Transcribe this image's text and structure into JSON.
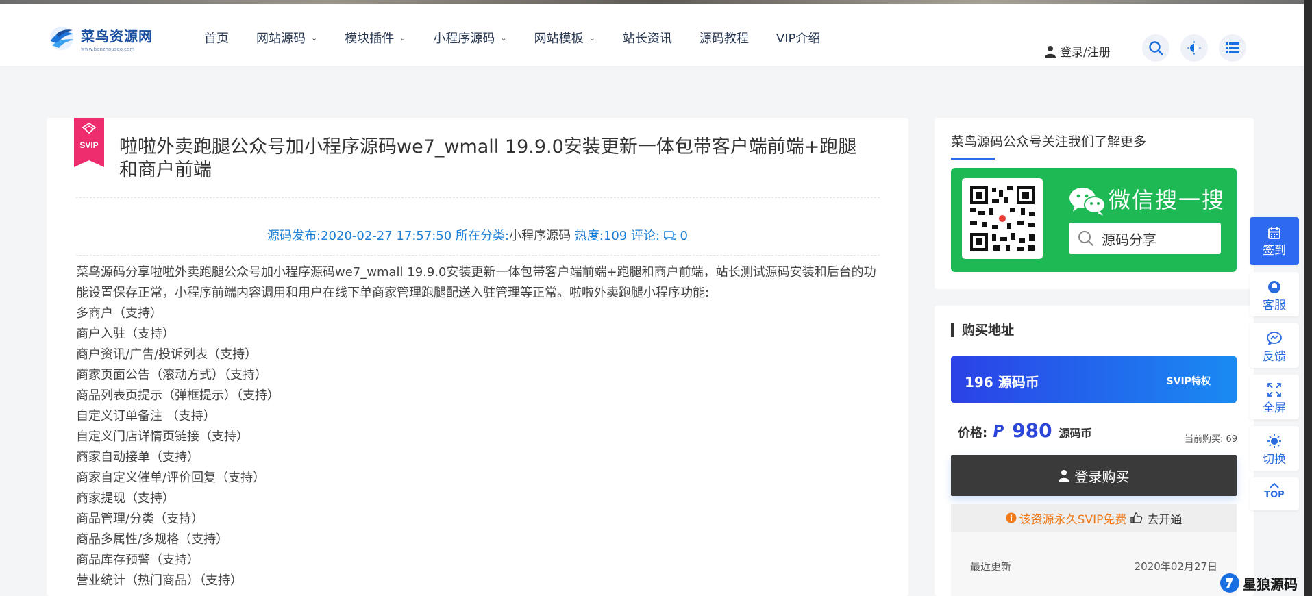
{
  "header": {
    "logo_title": "菜鸟资源网",
    "logo_sub": "www.banzhouseo.com",
    "nav": [
      {
        "label": "首页",
        "has_dropdown": false
      },
      {
        "label": "网站源码",
        "has_dropdown": true
      },
      {
        "label": "模块插件",
        "has_dropdown": true
      },
      {
        "label": "小程序源码",
        "has_dropdown": true
      },
      {
        "label": "网站模板",
        "has_dropdown": true
      },
      {
        "label": "站长资讯",
        "has_dropdown": false
      },
      {
        "label": "源码教程",
        "has_dropdown": false
      },
      {
        "label": "VIP介绍",
        "has_dropdown": false
      }
    ],
    "login_label": "登录/注册",
    "icons": [
      "search-icon",
      "theme-icon",
      "menu-icon"
    ]
  },
  "article": {
    "badge": "SVIP",
    "title": "啦啦外卖跑腿公众号加小程序源码we7_wmall 19.9.0安装更新一体包带客户端前端+跑腿和商户前端",
    "meta": {
      "publish_label": "源码发布:",
      "publish_date": "2020-02-27 17:57:50",
      "category_label": "所在分类:",
      "category": "小程序源码",
      "views_label": "热度:",
      "views": "109",
      "comments_label": "评论:",
      "comments": "0"
    },
    "intro": "菜鸟源码分享啦啦外卖跑腿公众号加小程序源码we7_wmall 19.9.0安装更新一体包带客户端前端+跑腿和商户前端，站长测试源码安装和后台的功能设置保存正常，小程序前端内容调用和用户在线下单商家管理跑腿配送入驻管理等正常。啦啦外卖跑腿小程序功能:",
    "features": [
      "多商户（支持）",
      "商户入驻（支持）",
      "商户资讯/广告/投诉列表（支持）",
      "商家页面公告（滚动方式）（支持）",
      "商品列表页提示（弹框提示）（支持）",
      "自定义订单备注 （支持）",
      "自定义门店详情页链接（支持）",
      "商家自动接单（支持）",
      "商家自定义催单/评价回复（支持）",
      "商家提现（支持）",
      "商品管理/分类（支持）",
      "商品多属性/多规格（支持）",
      "商品库存预警（支持）",
      "营业统计（热门商品）（支持）"
    ]
  },
  "sidebar": {
    "follow_title": "菜鸟源码公众号关注我们了解更多",
    "wechat_title": "微信搜一搜",
    "wechat_search": "源码分享",
    "buy_title": "购买地址",
    "coins_label": "196 源码币",
    "svip_label": "SVIP特权",
    "price_label": "价格:",
    "price_value": "980",
    "price_unit": "源码币",
    "sold_label": "当前购买: 69",
    "buy_button": "登录购买",
    "svip_free": "该资源永久SVIP免费",
    "go_open": "去开通",
    "recent_label": "最近更新",
    "recent_date": "2020年02月27日"
  },
  "float_toolbar": [
    {
      "label": "签到",
      "icon": "calendar-icon"
    },
    {
      "label": "客服",
      "icon": "chat-icon"
    },
    {
      "label": "反馈",
      "icon": "feedback-icon"
    },
    {
      "label": "全屏",
      "icon": "fullscreen-icon"
    },
    {
      "label": "切换",
      "icon": "sun-icon"
    },
    {
      "label": "TOP",
      "icon": "arrow-up-icon"
    }
  ],
  "watermark": "星狼源码",
  "colors": {
    "brand_blue": "#1a4fa0",
    "accent_blue": "#2d6af0",
    "svip_pink": "#ee2d6e",
    "wechat_green": "#1eb955",
    "dark_button": "#3a3a3a",
    "orange": "#f07a1a"
  }
}
